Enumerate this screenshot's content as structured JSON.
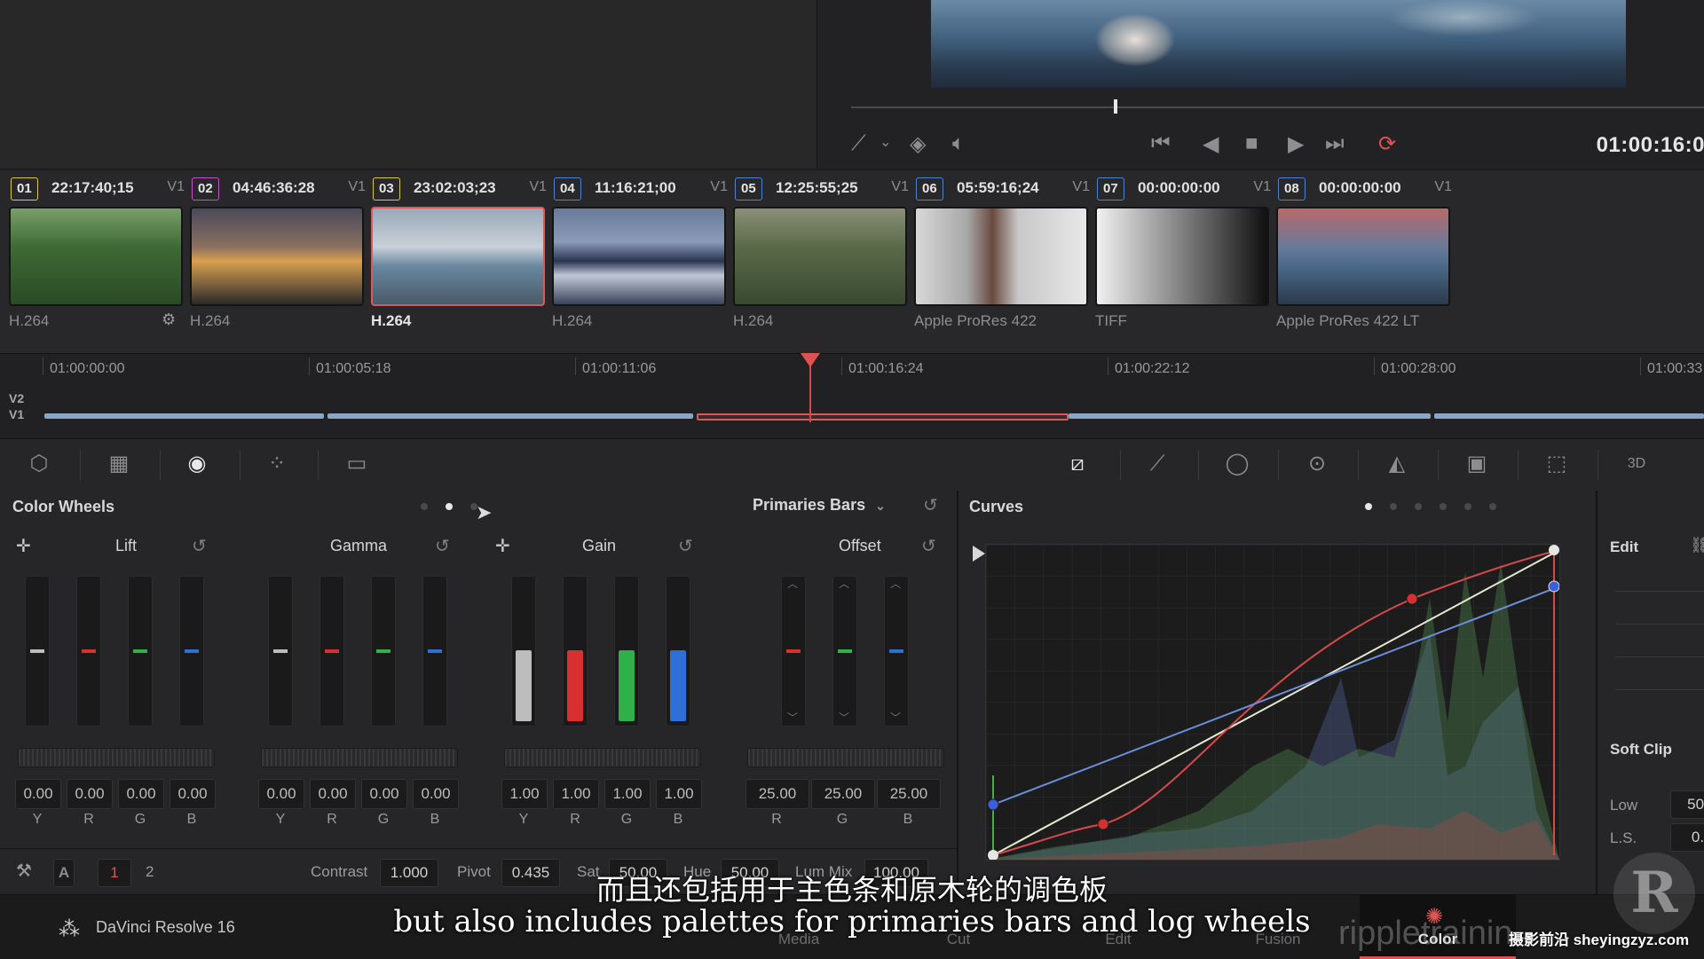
{
  "viewer": {
    "timecode": "01:00:16:0"
  },
  "clips": [
    {
      "num": "01",
      "tc": "22:17:40;15",
      "track": "V1",
      "codec": "H.264",
      "color": "#d9c94a"
    },
    {
      "num": "02",
      "tc": "04:46:36:28",
      "track": "V1",
      "codec": "H.264",
      "color": "#c553c8"
    },
    {
      "num": "03",
      "tc": "23:02:03;23",
      "track": "V1",
      "codec": "H.264",
      "color": "#d9c94a"
    },
    {
      "num": "04",
      "tc": "11:16:21;00",
      "track": "V1",
      "codec": "H.264",
      "color": "#4a84d4"
    },
    {
      "num": "05",
      "tc": "12:25:55;25",
      "track": "V1",
      "codec": "H.264",
      "color": "#4a84d4"
    },
    {
      "num": "06",
      "tc": "05:59:16;24",
      "track": "V1",
      "codec": "Apple ProRes 422",
      "color": "#4a84d4"
    },
    {
      "num": "07",
      "tc": "00:00:00:00",
      "track": "V1",
      "codec": "TIFF",
      "color": "#4a84d4"
    },
    {
      "num": "08",
      "tc": "00:00:00:00",
      "track": "V1",
      "codec": "Apple ProRes 422 LT",
      "color": "#4a84d4"
    }
  ],
  "timeline": {
    "ruler": [
      "01:00:00:00",
      "01:00:05:18",
      "01:00:11:06",
      "01:00:16:24",
      "01:00:22:12",
      "01:00:28:00",
      "01:00:33"
    ],
    "tracks": [
      "V2",
      "V1"
    ]
  },
  "color_wheels": {
    "title": "Color Wheels",
    "mode": "Primaries Bars",
    "groups": [
      {
        "name": "Lift",
        "values": [
          "0.00",
          "0.00",
          "0.00",
          "0.00"
        ],
        "channels": [
          "Y",
          "R",
          "G",
          "B"
        ]
      },
      {
        "name": "Gamma",
        "values": [
          "0.00",
          "0.00",
          "0.00",
          "0.00"
        ],
        "channels": [
          "Y",
          "R",
          "G",
          "B"
        ]
      },
      {
        "name": "Gain",
        "values": [
          "1.00",
          "1.00",
          "1.00",
          "1.00"
        ],
        "channels": [
          "Y",
          "R",
          "G",
          "B"
        ]
      },
      {
        "name": "Offset",
        "values": [
          "25.00",
          "25.00",
          "25.00"
        ],
        "channels": [
          "R",
          "G",
          "B"
        ]
      }
    ],
    "bottom": {
      "node_a": "A",
      "page1": "1",
      "page2": "2",
      "contrast_label": "Contrast",
      "contrast": "1.000",
      "pivot_label": "Pivot",
      "pivot": "0.435",
      "sat_label": "Sat",
      "sat": "50.00",
      "hue_label": "Hue",
      "hue": "50.00",
      "lummix_label": "Lum Mix",
      "lummix": "100.00"
    }
  },
  "curves": {
    "title": "Curves"
  },
  "edit_panel": {
    "edit_label": "Edit",
    "softclip_label": "Soft Clip",
    "low_label": "Low",
    "low": "50.",
    "ls_label": "L.S.",
    "ls": "0."
  },
  "footer": {
    "app_name": "DaVinci Resolve 16",
    "tabs": [
      "Media",
      "Cut",
      "Edit",
      "Fusion",
      "Color"
    ],
    "watermark": "rippletrainin",
    "site": "摄影前沿 sheyingzyz.com"
  },
  "subtitles": {
    "cn": "而且还包括用于主色条和原木轮的调色板",
    "en": "but also includes palettes for primaries bars and log wheels"
  }
}
